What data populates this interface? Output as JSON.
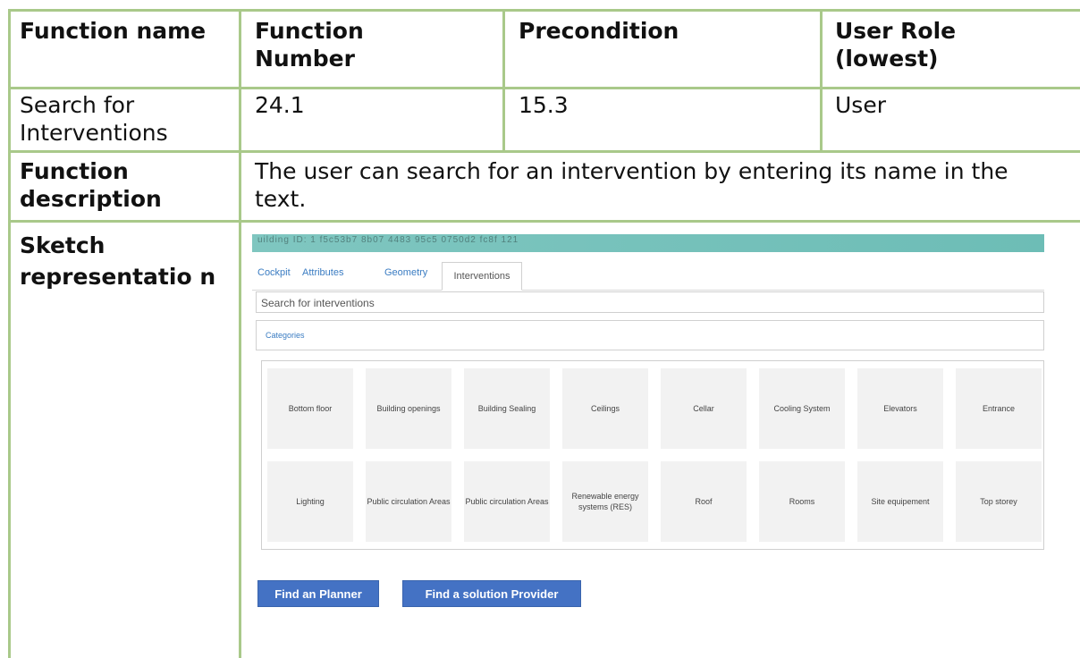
{
  "header": {
    "function_name": "Function name",
    "function_number": "Function Number",
    "precondition": "Precondition",
    "user_role": "User Role (lowest)"
  },
  "row": {
    "function_name": "Search for Interventions",
    "function_number": "24.1",
    "precondition": "15.3",
    "user_role": "User"
  },
  "description": {
    "label": "Function description",
    "text": "The user can search for an intervention by entering its name in the text."
  },
  "sketch": {
    "label": "Sketch representatio n",
    "banner_text": "uilding ID: 1 f5c53b7 8b07 4483 95c5 0750d2 fc8f 121",
    "tabs": [
      "Cockpit",
      "Attributes",
      "Geometry"
    ],
    "active_tab": "Interventions",
    "search_placeholder": "Search for interventions",
    "categories_label": "Categories",
    "tiles": [
      "Bottom floor",
      "Building openings",
      "Building Sealing",
      "Ceilings",
      "Cellar",
      "Cooling System",
      "Elevators",
      "Entrance",
      "Lighting",
      "Public circulation Areas",
      "Public circulation Areas",
      "Renewable energy systems (RES)",
      "Roof",
      "Rooms",
      "Site equipement",
      "Top storey"
    ],
    "buttons": {
      "planner": "Find an Planner",
      "provider": "Find a solution Provider"
    }
  },
  "colors": {
    "border": "#a9c98a",
    "button": "#4472c4",
    "banner": "#7fc6c0",
    "link": "#3a7cc2"
  }
}
